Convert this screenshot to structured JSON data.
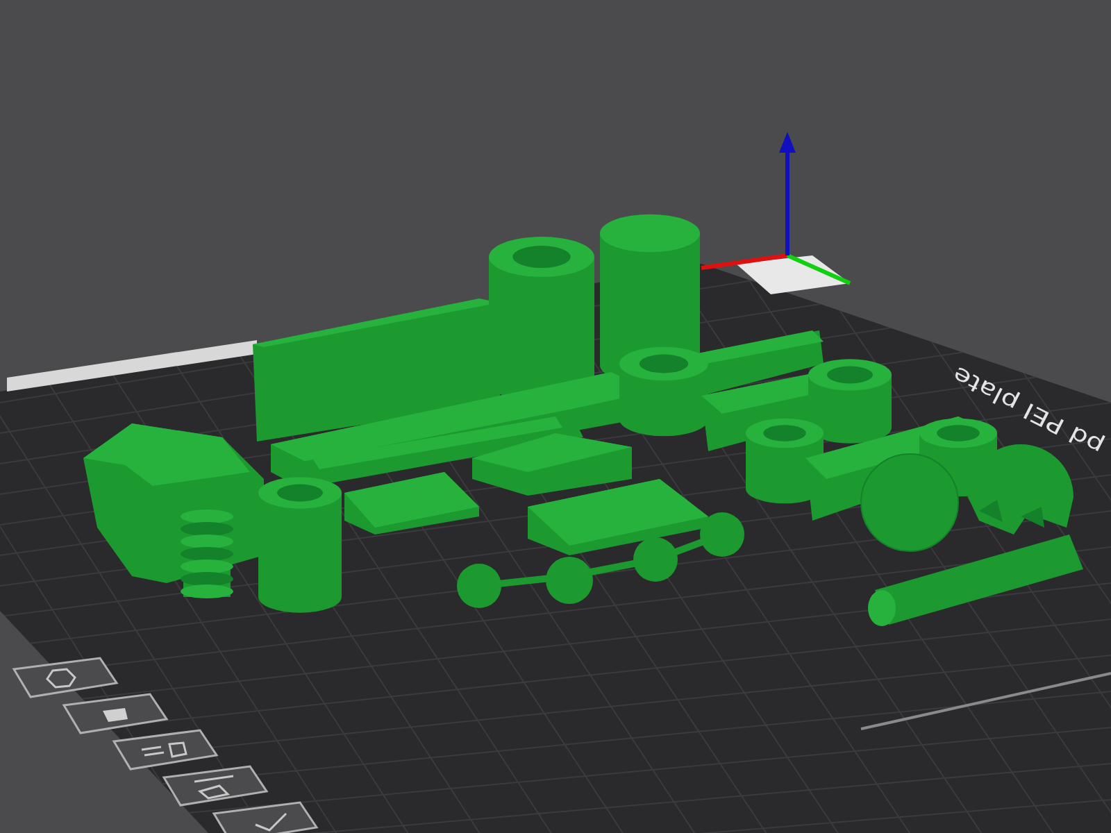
{
  "viewport": {
    "bed_label": "pd PEI plate"
  }
}
